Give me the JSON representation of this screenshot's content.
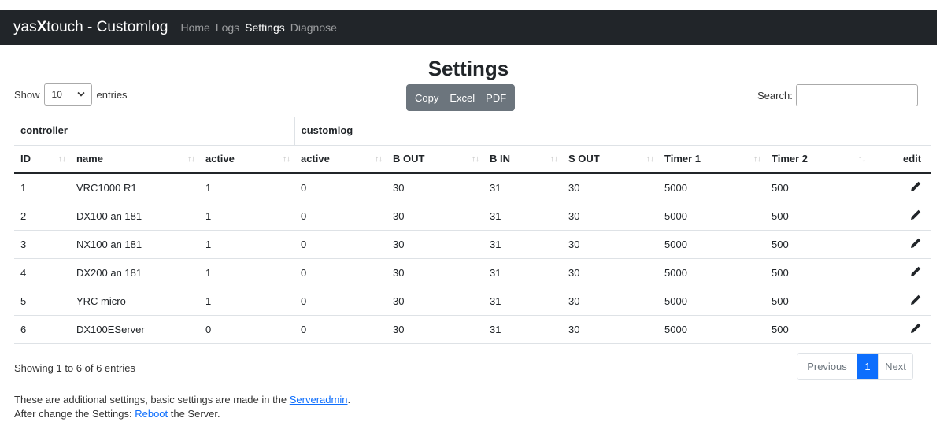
{
  "navbar": {
    "brand_prefix": "yas",
    "brand_x": "X",
    "brand_suffix": "touch - Customlog",
    "links": [
      "Home",
      "Logs",
      "Settings",
      "Diagnose"
    ],
    "active_link": "Settings"
  },
  "page": {
    "title": "Settings"
  },
  "length_control": {
    "label_before": "Show",
    "selected": "10",
    "label_after": "entries"
  },
  "export_buttons": [
    "Copy",
    "Excel",
    "PDF"
  ],
  "search": {
    "label": "Search:",
    "value": "",
    "placeholder": ""
  },
  "table": {
    "groups": [
      "controller",
      "customlog"
    ],
    "columns": [
      "ID",
      "name",
      "active",
      "active",
      "B OUT",
      "B IN",
      "S OUT",
      "Timer 1",
      "Timer 2",
      "edit"
    ],
    "sort_glyph": "↑↓",
    "rows": [
      [
        "1",
        "VRC1000 R1",
        "1",
        "0",
        "30",
        "31",
        "30",
        "5000",
        "500"
      ],
      [
        "2",
        "DX100 an 181",
        "1",
        "0",
        "30",
        "31",
        "30",
        "5000",
        "500"
      ],
      [
        "3",
        "NX100 an 181",
        "1",
        "0",
        "30",
        "31",
        "30",
        "5000",
        "500"
      ],
      [
        "4",
        "DX200 an 181",
        "1",
        "0",
        "30",
        "31",
        "30",
        "5000",
        "500"
      ],
      [
        "5",
        "YRC micro",
        "1",
        "0",
        "30",
        "31",
        "30",
        "5000",
        "500"
      ],
      [
        "6",
        "DX100EServer",
        "0",
        "0",
        "30",
        "31",
        "30",
        "5000",
        "500"
      ]
    ],
    "edit_icon": "pencil-icon"
  },
  "info": "Showing 1 to 6 of 6 entries",
  "pagination": {
    "previous": "Previous",
    "current": "1",
    "next": "Next"
  },
  "notes": {
    "line1_before": "These are additional settings, basic settings are made in the ",
    "line1_link": "Serveradmin",
    "line1_after": ".",
    "line2_before": "After change the Settings: ",
    "line2_link": "Reboot",
    "line2_after": " the Server."
  },
  "colors": {
    "navbar": "#212529",
    "export_buttons": "#6c757d",
    "link": "#0d6efd",
    "page_active": "#0d6efd"
  }
}
